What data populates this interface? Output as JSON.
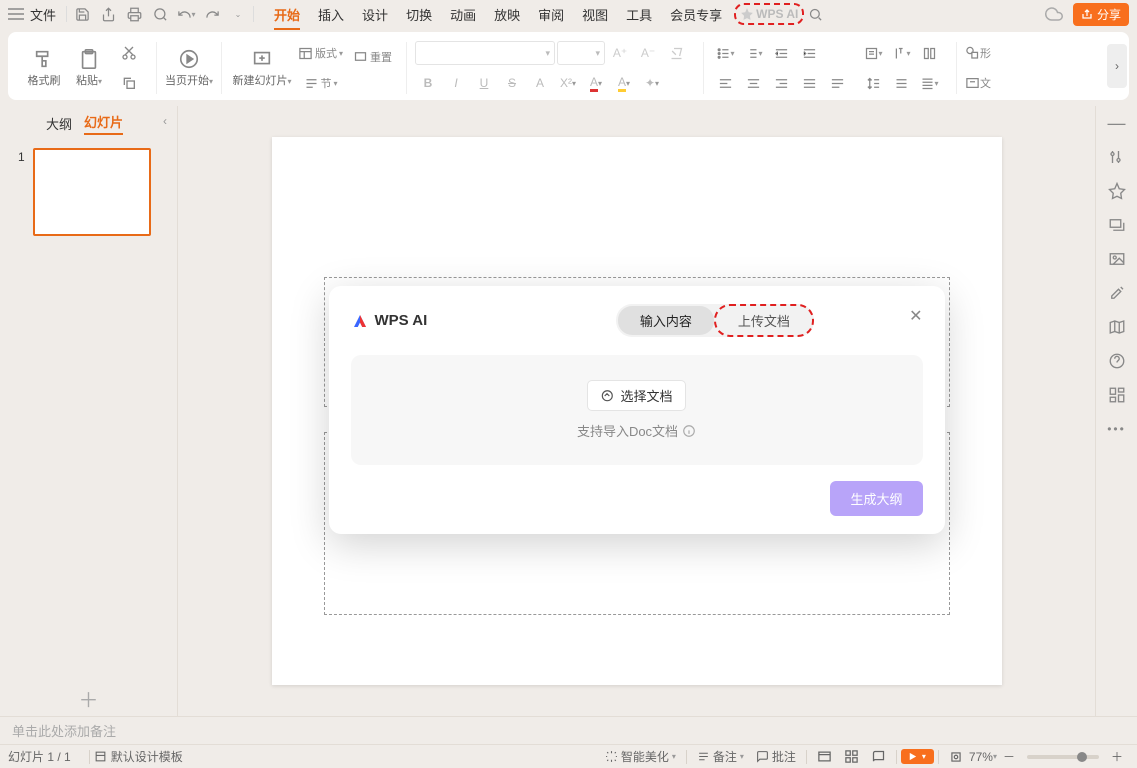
{
  "menubar": {
    "file": "文件",
    "tabs": [
      "开始",
      "插入",
      "设计",
      "切换",
      "动画",
      "放映",
      "审阅",
      "视图",
      "工具",
      "会员专享"
    ],
    "active_tab": 0,
    "wps_ai": "WPS AI",
    "share": "分享"
  },
  "ribbon": {
    "format_painter": "格式刷",
    "paste": "粘贴",
    "from_current": "当页开始",
    "new_slide": "新建幻灯片",
    "layout": "版式",
    "section": "节",
    "reset": "重置",
    "shape": "形"
  },
  "leftpanel": {
    "tab_outline": "大纲",
    "tab_slides": "幻灯片",
    "slide_number": "1"
  },
  "ai_modal": {
    "title": "WPS AI",
    "mode_input": "输入内容",
    "mode_upload": "上传文档",
    "choose_doc": "选择文档",
    "support_text": "支持导入Doc文档",
    "generate": "生成大纲"
  },
  "notes_placeholder": "单击此处添加备注",
  "statusbar": {
    "slide_pos": "幻灯片 1 / 1",
    "template": "默认设计模板",
    "beautify": "智能美化",
    "notes": "备注",
    "comments": "批注",
    "zoom": "77%"
  }
}
